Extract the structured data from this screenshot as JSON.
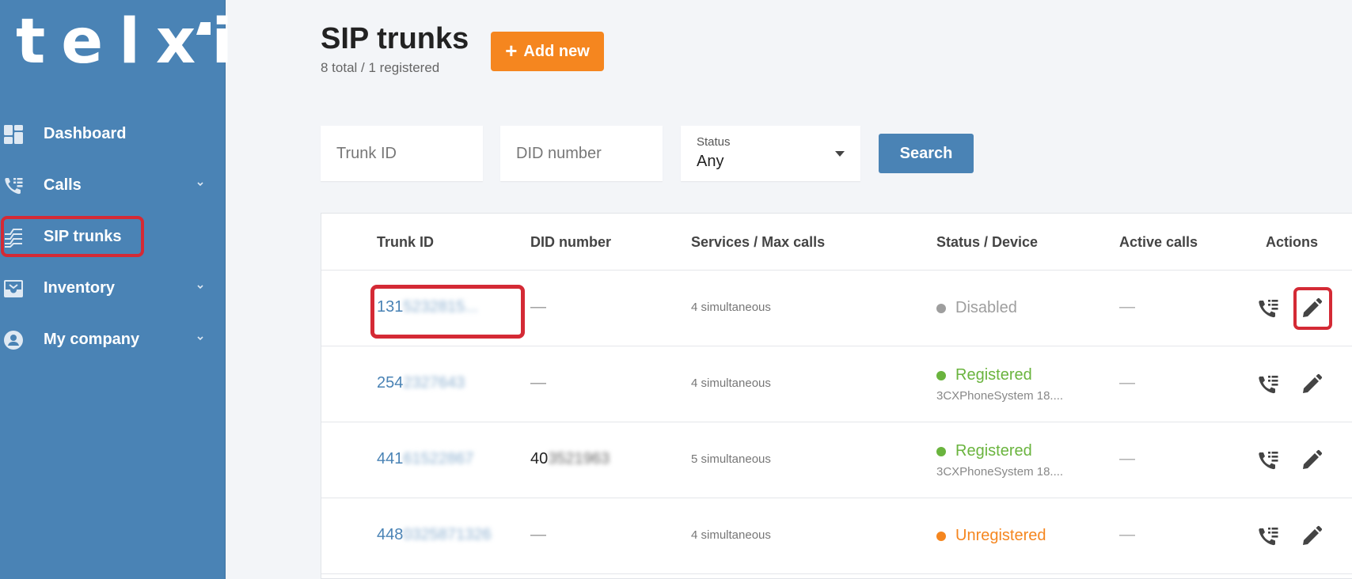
{
  "brand": {
    "logo_text": "telxi"
  },
  "sidebar": {
    "items": [
      {
        "label": "Dashboard",
        "icon": "dashboard-icon",
        "has_chevron": false
      },
      {
        "label": "Calls",
        "icon": "phone-list-icon",
        "has_chevron": true
      },
      {
        "label": "SIP trunks",
        "icon": "sip-trunks-icon",
        "has_chevron": false,
        "active": true
      },
      {
        "label": "Inventory",
        "icon": "inbox-icon",
        "has_chevron": true
      },
      {
        "label": "My company",
        "icon": "user-circle-icon",
        "has_chevron": true
      }
    ]
  },
  "header": {
    "title": "SIP trunks",
    "subtitle": "8 total / 1 registered",
    "add_button": "Add new"
  },
  "filters": {
    "trunk_id_placeholder": "Trunk ID",
    "did_placeholder": "DID number",
    "status_label": "Status",
    "status_value": "Any",
    "search_button": "Search"
  },
  "table": {
    "columns": [
      "Trunk ID",
      "DID number",
      "Services / Max calls",
      "Status / Device",
      "Active calls",
      "Actions"
    ],
    "rows": [
      {
        "trunk_id_visible": "131",
        "trunk_id_blurred": "5232815...",
        "did_visible": "—",
        "did_blurred": "",
        "services": "4 simultaneous",
        "status": "Disabled",
        "device": "",
        "active_calls": "—"
      },
      {
        "trunk_id_visible": "254",
        "trunk_id_blurred": "2327643",
        "did_visible": "—",
        "did_blurred": "",
        "services": "4 simultaneous",
        "status": "Registered",
        "device": "3CXPhoneSystem 18....",
        "active_calls": "—"
      },
      {
        "trunk_id_visible": "441",
        "trunk_id_blurred": "61522867",
        "did_visible": "40",
        "did_blurred": "3521963",
        "services": "5 simultaneous",
        "status": "Registered",
        "device": "3CXPhoneSystem 18....",
        "active_calls": "—"
      },
      {
        "trunk_id_visible": "448",
        "trunk_id_blurred": "0325871326",
        "did_visible": "—",
        "did_blurred": "",
        "services": "4 simultaneous",
        "status": "Unregistered",
        "device": "",
        "active_calls": "—"
      }
    ]
  },
  "colors": {
    "sidebar": "#4a83b5",
    "accent_orange": "#f5861f",
    "highlight_red": "#d42a35",
    "status_disabled": "#9e9e9e",
    "status_registered": "#6ab43e",
    "status_unregistered": "#f5861f"
  }
}
